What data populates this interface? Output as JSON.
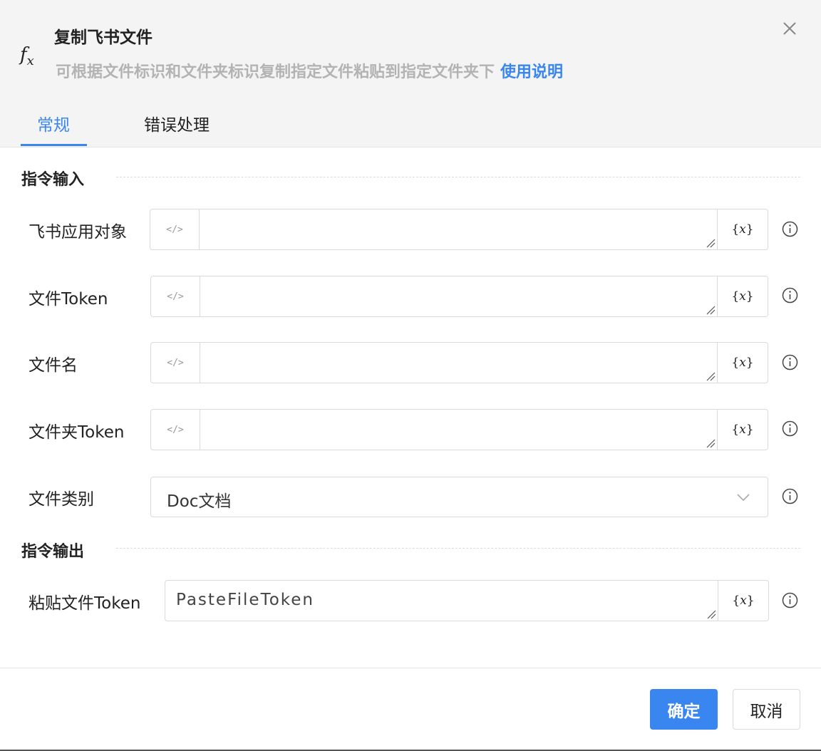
{
  "header": {
    "icon": "fx-icon",
    "title": "复制飞书文件",
    "description": "可根据文件标识和文件夹标识复制指定文件粘贴到指定文件夹下",
    "help_link": "使用说明"
  },
  "tabs": [
    {
      "label": "常规",
      "active": true
    },
    {
      "label": "错误处理",
      "active": false
    }
  ],
  "sections": {
    "input_title": "指令输入",
    "output_title": "指令输出"
  },
  "inputs": [
    {
      "label": "飞书应用对象",
      "value": ""
    },
    {
      "label": "文件Token",
      "value": ""
    },
    {
      "label": "文件名",
      "value": ""
    },
    {
      "label": "文件夹Token",
      "value": ""
    }
  ],
  "file_type": {
    "label": "文件类别",
    "selected": "Doc文档"
  },
  "output": {
    "label": "粘贴文件Token",
    "value": "PasteFileToken"
  },
  "code_icon_text": "</>",
  "variable_button_text": "x",
  "buttons": {
    "confirm": "确定",
    "cancel": "取消"
  },
  "colors": {
    "accent": "#3a86f0",
    "header_bg": "#f4f4f4"
  }
}
